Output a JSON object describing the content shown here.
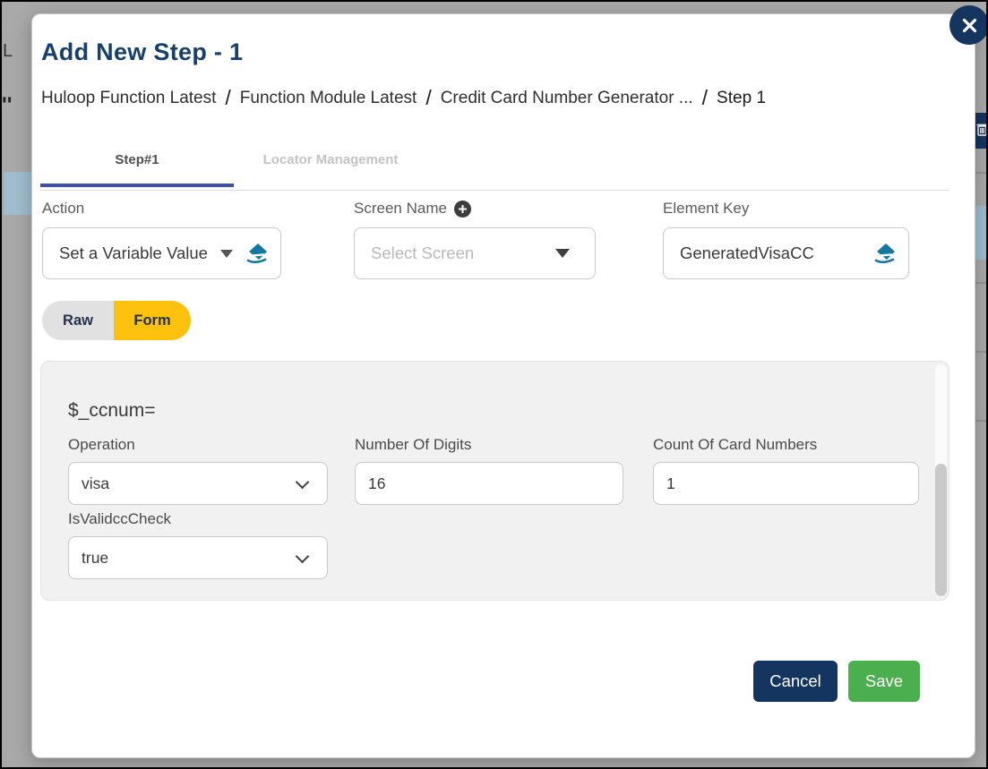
{
  "backdrop": {
    "fragments": {
      "left_text_1": "L",
      "left_text_2": "''"
    }
  },
  "modal": {
    "title": "Add New Step - 1",
    "breadcrumb": {
      "items": [
        "Huloop Function Latest",
        "Function Module Latest",
        "Credit Card Number Generator ...",
        "Step 1"
      ],
      "separator": "/"
    },
    "tabs": [
      {
        "label": "Step#1",
        "active": true
      },
      {
        "label": "Locator Management",
        "active": false
      }
    ],
    "fields": {
      "action": {
        "label": "Action",
        "value": "Set a Variable Value"
      },
      "screen_name": {
        "label": "Screen Name",
        "placeholder": "Select Screen"
      },
      "element_key": {
        "label": "Element Key",
        "value": "GeneratedVisaCC"
      }
    },
    "mode_toggle": {
      "options": [
        "Raw",
        "Form"
      ],
      "selected": "Form"
    },
    "form_panel": {
      "heading": "$_ccnum=",
      "fields": {
        "operation": {
          "label": "Operation",
          "value": "visa"
        },
        "number_of_digits": {
          "label": "Number Of Digits",
          "value": "16"
        },
        "count_of_card_numbers": {
          "label": "Count Of Card Numbers",
          "value": "1"
        },
        "isvalidcccheck": {
          "label": "IsValidccCheck",
          "value": "true"
        }
      }
    },
    "buttons": {
      "cancel": "Cancel",
      "save": "Save"
    }
  },
  "icons": {
    "close": "x-in-circle",
    "clear": "eraser",
    "dropdown": "caret-down",
    "add_screen": "plus-in-circle",
    "select_chevron": "chevron-down",
    "trash": "trash-can"
  },
  "colors": {
    "navy": "#14355f",
    "title_navy": "#17406d",
    "amber": "#fec10d",
    "green": "#4bae4f",
    "teal_eraser": "#15789e",
    "tab_underline": "#3c51a5",
    "backdrop_gray": "#a9a9a9",
    "panel_bg": "#f1f1f1",
    "artifact_blue": "#9fbdcf"
  }
}
